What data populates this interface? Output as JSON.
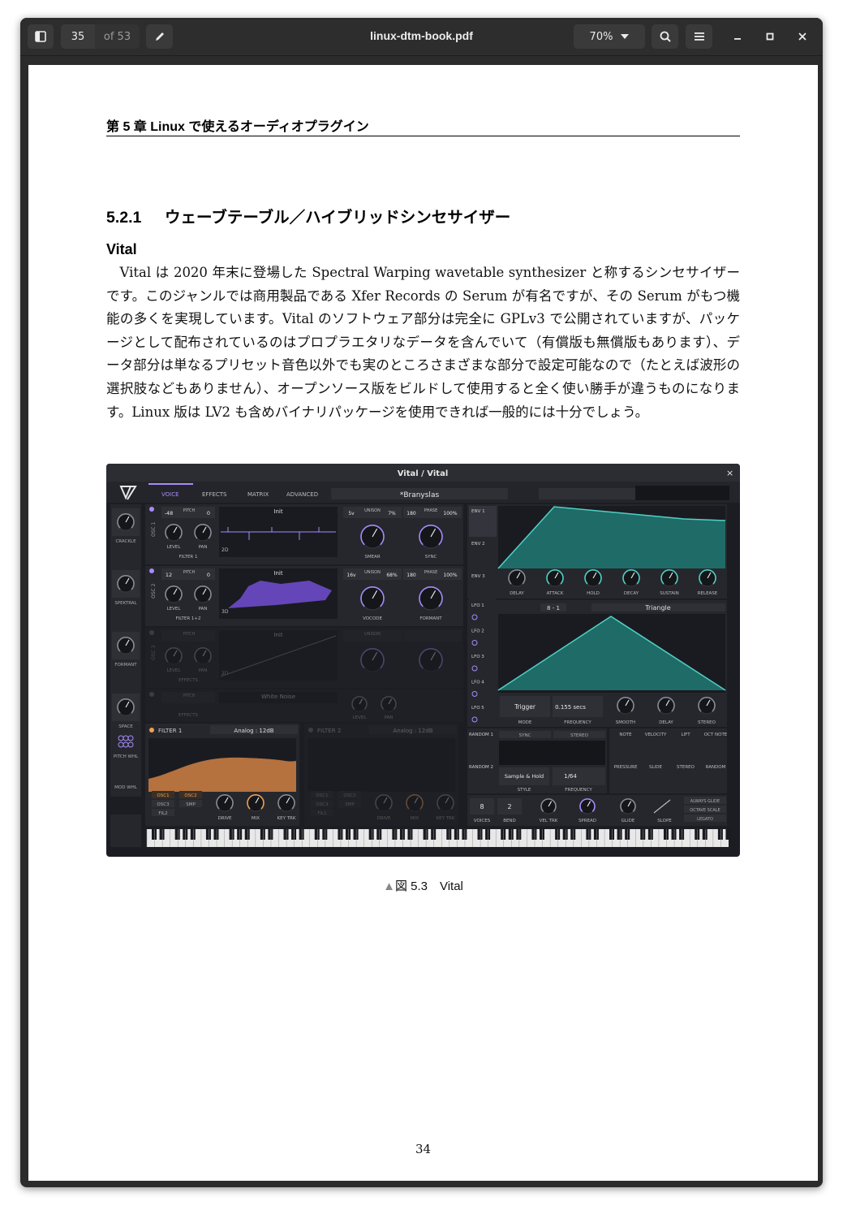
{
  "viewer": {
    "current_page": "35",
    "page_total": "of 53",
    "title": "linux-dtm-book.pdf",
    "zoom": "70%"
  },
  "page": {
    "running_header": "第 5 章 Linux で使えるオーディオプラグイン",
    "section_number": "5.2.1",
    "section_title": "ウェーブテーブル／ハイブリッドシンセサイザー",
    "subsection": "Vital",
    "paragraph": "Vital は 2020 年末に登場した Spectral Warping wavetable synthesizer と称するシンセサイザーです。このジャンルでは商用製品である Xfer Records の Serum が有名ですが、その Serum がもつ機能の多くを実現しています。Vital のソフトウェア部分は完全に GPLv3 で公開されていますが、パッケージとして配布されているのはプロプラエタリなデータを含んでいて（有償版も無償版もあります）、データ部分は単なるプリセット音色以外でも実のところさまざまな部分で設定可能なので（たとえば波形の選択肢などもありません）、オープンソース版をビルドして使用すると全く使い勝手が違うものになります。Linux 版は LV2 も含めバイナリパッケージを使用できれば一般的には十分でしょう。",
    "caption_marker": "▲",
    "caption": "図 5.3　Vital",
    "page_number": "34"
  },
  "vital": {
    "window_title": "Vital / Vital",
    "close": "×",
    "tabs": [
      "VOICE",
      "EFFECTS",
      "MATRIX",
      "ADVANCED"
    ],
    "preset": "*Branyslas",
    "left_knobs": [
      "CRACKLE",
      "SPEKTRAL",
      "FORMANT",
      "SPACE"
    ],
    "pitch_whl": "PITCH WHL",
    "mod_whl": "MOD WHL",
    "osc1": {
      "label": "OSC 1",
      "pitch": "-48",
      "pitch_lbl": "PITCH",
      "pan_val": "0",
      "wave": "Init",
      "dim": "2D",
      "unison": "5v",
      "unison_lbl": "UNISON",
      "unison_pct": "7%",
      "phase": "180",
      "phase_lbl": "PHASE",
      "phase_pct": "100%",
      "filter": "FILTER 1",
      "mode1": "SMEAR",
      "mode2": "SYNC",
      "level": "LEVEL",
      "pan": "PAN"
    },
    "osc2": {
      "label": "OSC 2",
      "pitch": "12",
      "pitch_lbl": "PITCH",
      "pan_val": "0",
      "wave": "Init",
      "dim": "3D",
      "unison": "16v",
      "unison_lbl": "UNISON",
      "unison_pct": "68%",
      "phase": "180",
      "phase_lbl": "PHASE",
      "phase_pct": "100%",
      "filter": "FILTER 1+2",
      "mode1": "VOCODE",
      "mode2": "FORMANT",
      "level": "LEVEL",
      "pan": "PAN"
    },
    "osc3": {
      "label": "OSC 3",
      "pitch_lbl": "PITCH",
      "wave": "Init",
      "dim": "2D",
      "unison_lbl": "UNISON",
      "filter": "EFFECTS",
      "level": "LEVEL",
      "pan": "PAN"
    },
    "smp": {
      "label": "SMP",
      "pitch_lbl": "PITCH",
      "wave": "White Noise",
      "filter": "EFFECTS",
      "level": "LEVEL",
      "pan": "PAN"
    },
    "filter1": {
      "label": "FILTER 1",
      "type": "Analog : 12dB",
      "src": [
        "OSC1",
        "OSC2",
        "OSC3",
        "SMP",
        "FIL2"
      ],
      "knobs": [
        "DRIVE",
        "MIX",
        "KEY TRK"
      ]
    },
    "filter2": {
      "label": "FILTER 2",
      "type": "Analog : 12dB",
      "src": [
        "OSC1",
        "OSC2",
        "OSC3",
        "SMP",
        "FIL1"
      ],
      "knobs": [
        "DRIVE",
        "MIX",
        "KEY TRK"
      ]
    },
    "env_tabs": [
      "ENV 1",
      "ENV 2",
      "ENV 3"
    ],
    "env_knobs": [
      "DELAY",
      "ATTACK",
      "HOLD",
      "DECAY",
      "SUSTAIN",
      "RELEASE"
    ],
    "lfo_tabs": [
      "LFO 1",
      "LFO 2",
      "LFO 3",
      "LFO 4",
      "LFO 5"
    ],
    "lfo_grid": "8 - 1",
    "lfo_shape": "Triangle",
    "lfo_mode": "Trigger",
    "lfo_freq": "0.155 secs",
    "lfo_labels": [
      "MODE",
      "FREQUENCY",
      "SMOOTH",
      "DELAY",
      "STEREO"
    ],
    "random": [
      "RANDOM 1",
      "RANDOM 2"
    ],
    "random_btns": [
      "SYNC",
      "STEREO"
    ],
    "random_style": "Sample & Hold",
    "random_freq": "1/64",
    "random_labels": [
      "STYLE",
      "FREQUENCY"
    ],
    "mod_src": [
      "NOTE",
      "VELOCITY",
      "LIFT",
      "OCT NOTE",
      "PRESSURE",
      "SLIDE",
      "STEREO",
      "RANDOM"
    ],
    "voices": "8",
    "bend": "2",
    "voice_labels": [
      "VOICES",
      "BEND",
      "VEL TRK",
      "SPREAD",
      "GLIDE",
      "SLOPE"
    ],
    "glide_opts": [
      "ALWAYS GLIDE",
      "OCTAVE SCALE",
      "LEGATO"
    ]
  }
}
